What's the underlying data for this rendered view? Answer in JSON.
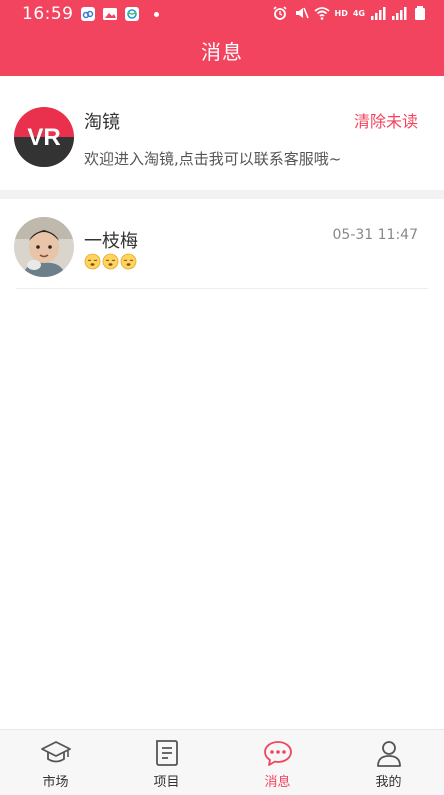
{
  "status_bar": {
    "time": "16:59",
    "network": "4G",
    "hd": "HD"
  },
  "header": {
    "title": "消息"
  },
  "system_message": {
    "name": "淘镜",
    "clear_label": "清除未读",
    "preview": "欢迎进入淘镜,点击我可以联系客服哦~",
    "logo_text": "VR"
  },
  "chats": [
    {
      "name": "一枝梅",
      "time": "05-31 11:47",
      "preview_icons": [
        "sleepy-face-emoji",
        "sleepy-face-emoji",
        "sleepy-face-emoji"
      ]
    }
  ],
  "tabs": [
    {
      "label": "市场",
      "icon": "graduation-cap-icon"
    },
    {
      "label": "项目",
      "icon": "document-icon"
    },
    {
      "label": "消息",
      "icon": "chat-bubble-icon",
      "active": true
    },
    {
      "label": "我的",
      "icon": "user-icon"
    }
  ],
  "colors": {
    "accent": "#f2445f",
    "divider": "#f2f2f2",
    "tabbar": "#f7f7f7"
  }
}
